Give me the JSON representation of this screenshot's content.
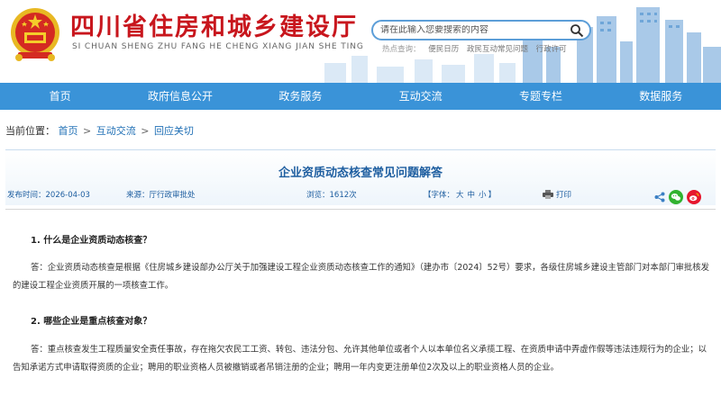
{
  "header": {
    "site_title": "四川省住房和城乡建设厅",
    "site_subtitle": "SI CHUAN SHENG ZHU FANG HE CHENG XIANG JIAN SHE TING",
    "search": {
      "placeholder": "请在此输入您要搜索的内容"
    },
    "hot_label": "热点查询：",
    "hot_links": [
      "便民日历",
      "政民互动常见问题",
      "行政许可"
    ]
  },
  "nav": [
    "首页",
    "政府信息公开",
    "政务服务",
    "互动交流",
    "专题专栏",
    "数据服务"
  ],
  "breadcrumb": {
    "label": "当前位置：",
    "items": [
      "首页",
      "互动交流",
      "回应关切"
    ],
    "sep": ">"
  },
  "article": {
    "title": "企业资质动态核查常见问题解答",
    "date": "发布时间：2026-04-03",
    "source": "来源：厅行政审批处",
    "views": "浏览：1612次",
    "font_open": "【字体：",
    "font_sizes": [
      "大",
      "中",
      "小"
    ],
    "font_close": "】",
    "print": "打印",
    "q1": "1. 什么是企业资质动态核查？",
    "a1": "答：企业资质动态核查是根据《住房城乡建设部办公厅关于加强建设工程企业资质动态核查工作的通知》（建办市〔2024〕52号）要求，各级住房城乡建设主管部门对本部门审批核发的建设工程企业资质开展的一项核查工作。",
    "q2": "2. 哪些企业是重点核查对象？",
    "a2": "答：重点核查发生工程质量安全责任事故，存在拖欠农民工工资、转包、违法分包、允许其他单位或者个人以本单位名义承揽工程、在资质申请中弄虚作假等违法违规行为的企业；以告知承诺方式申请取得资质的企业；聘用的职业资格人员被撤销或者吊销注册的企业；聘用一年内变更注册单位2次及以上的职业资格人员的企业。"
  },
  "colors": {
    "title_red": "#c8161d",
    "nav_blue": "#3a93d8",
    "link_blue": "#1e5ea0"
  },
  "icons": [
    "national-emblem",
    "search-icon",
    "printer-icon",
    "share-icon",
    "wechat-icon",
    "weibo-icon"
  ]
}
